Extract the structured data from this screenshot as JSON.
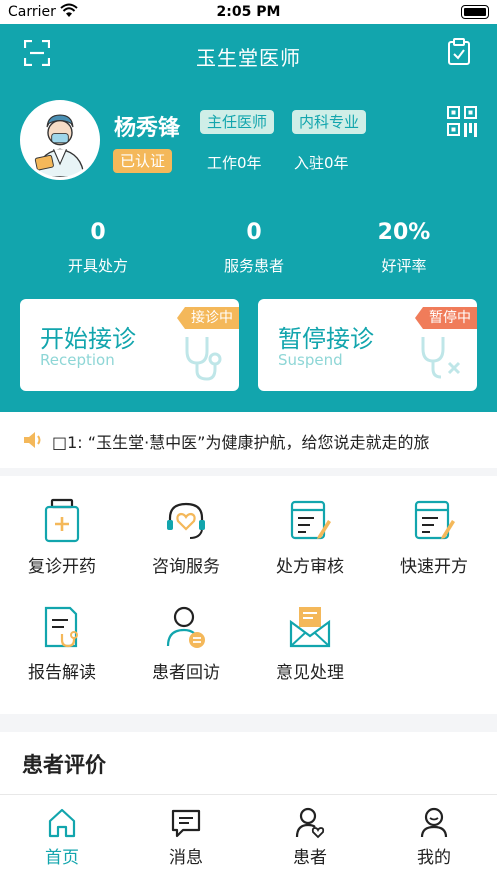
{
  "status_bar": {
    "carrier": "Carrier",
    "time": "2:05 PM"
  },
  "nav": {
    "title": "玉生堂医师"
  },
  "profile": {
    "name": "杨秀锋",
    "title_tag": "主任医师",
    "dept_tag": "内科专业",
    "verified": "已认证",
    "work_years": "工作0年",
    "joined_years": "入驻0年"
  },
  "stats": [
    {
      "value": "0",
      "label": "开具处方"
    },
    {
      "value": "0",
      "label": "服务患者"
    },
    {
      "value": "20%",
      "label": "好评率"
    }
  ],
  "cards": {
    "start": {
      "title": "开始接诊",
      "subtitle": "Reception",
      "badge": "接诊中"
    },
    "pause": {
      "title": "暂停接诊",
      "subtitle": "Suspend",
      "badge": "暂停中"
    }
  },
  "notice": {
    "text": "□1: “玉生堂·慧中医”为健康护航，给您说走就走的旅"
  },
  "services": [
    {
      "label": "复诊开药",
      "icon": "medicine-jar-icon"
    },
    {
      "label": "咨询服务",
      "icon": "headset-heart-icon"
    },
    {
      "label": "处方审核",
      "icon": "prescription-edit-icon"
    },
    {
      "label": "快速开方",
      "icon": "prescription-pen-icon"
    },
    {
      "label": "报告解读",
      "icon": "report-stethoscope-icon"
    },
    {
      "label": "患者回访",
      "icon": "patient-revisit-icon"
    },
    {
      "label": "意见处理",
      "icon": "feedback-mail-icon"
    }
  ],
  "reviews": {
    "title": "患者评价"
  },
  "tabs": [
    {
      "label": "首页",
      "icon": "home-icon",
      "active": true
    },
    {
      "label": "消息",
      "icon": "message-icon",
      "active": false
    },
    {
      "label": "患者",
      "icon": "patient-icon",
      "active": false
    },
    {
      "label": "我的",
      "icon": "profile-icon",
      "active": false
    }
  ],
  "colors": {
    "primary": "#12a5ad",
    "orange": "#f4b85a",
    "red_orange": "#f07c5a"
  }
}
